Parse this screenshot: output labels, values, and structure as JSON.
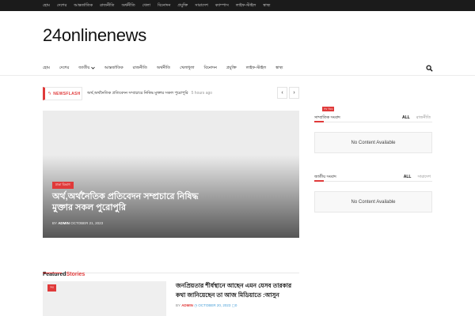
{
  "topbar": {
    "items": [
      "হোম",
      "দেশের",
      "আন্তর্জাতিক",
      "রাজনীতি",
      "অর্থনীতি",
      "খেলা",
      "বিনোদন",
      "প্রযুক্তি",
      "সারাদেশ",
      "ক্যাম্পাস",
      "লাইফ-স্টাইল",
      "স্বাস্থ্য"
    ]
  },
  "site": {
    "logo": "24onlinenews"
  },
  "mainnav": {
    "items": [
      "হোম",
      "দেশের",
      "জাতীয়",
      "আন্তর্জাতিক",
      "রাজনীতি",
      "অর্থনীতি",
      "খেলাধুলা",
      "বিনোদন",
      "প্রযুক্তি",
      "লাইফ-স্টাইল",
      "স্বাস্থ্য"
    ],
    "dropdown_index": 2
  },
  "ticker": {
    "label": "NEWSFLASH",
    "headline": "অর্থ,অর্থনৈতিক প্রতিবেদন সম্প্রচারে নিষিদ্ধ মুক্তার সকল পুরোপুরি",
    "time": "5 hours ago"
  },
  "hero": {
    "category": "ঢাকা বিভাগ",
    "title": "অর্থ,অর্থনৈতিক প্রতিবেদন সম্প্রচারে নিষিদ্ধ মুক্তার সকল পুরোপুরি",
    "by": "BY",
    "author": "ADMIN",
    "date": "OCTOBER 21, 2023"
  },
  "featured": {
    "title_part1": "Featured",
    "title_part2": "Stories",
    "item": {
      "category": "সব",
      "title": "জনপ্রিয়তার শীর্ষস্থানে আছেন এমন যেসব তারকার কথা জানিয়েছেন তা আজ মিডিয়াতে :আসুন",
      "by": "BY",
      "author": "ADMIN",
      "date": "OCTOBER 20, 2023",
      "comments": "0"
    }
  },
  "widget1": {
    "tag": "সব খবর",
    "title": "সাম্প্রতিক সংবাদ",
    "tab_all": "ALL",
    "tab_other": "রাজনীতি",
    "empty": "No Content Available"
  },
  "widget2": {
    "title": "জাতীয় সংবাদ",
    "tab_all": "ALL",
    "tab_other": "সারাদেশ",
    "empty": "No Content Available"
  },
  "colors": {
    "accent": "#e03a3a",
    "topbar": "#1b1b1b",
    "link": "#4aa0d8"
  }
}
